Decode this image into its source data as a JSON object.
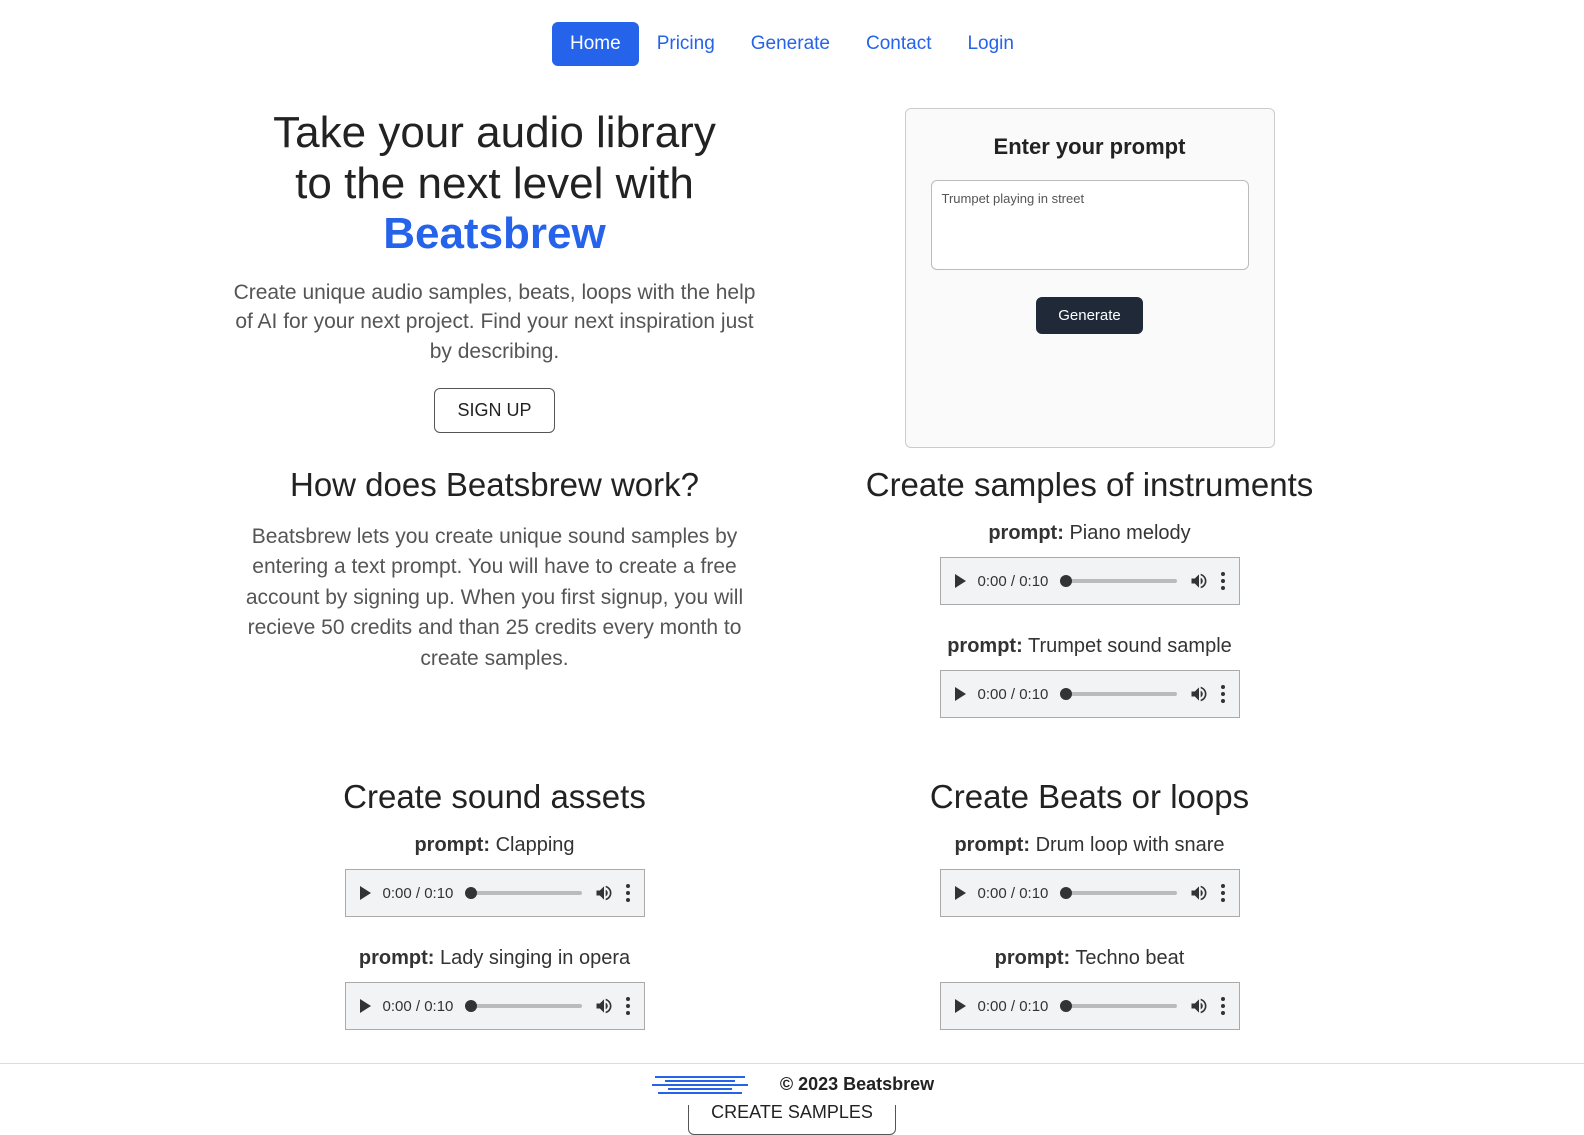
{
  "nav": {
    "items": [
      {
        "label": "Home",
        "active": true
      },
      {
        "label": "Pricing",
        "active": false
      },
      {
        "label": "Generate",
        "active": false
      },
      {
        "label": "Contact",
        "active": false
      },
      {
        "label": "Login",
        "active": false
      }
    ]
  },
  "hero": {
    "title_line1": "Take your audio library",
    "title_line2": "to the next level with",
    "brand": "Beatsbrew",
    "description": "Create unique audio samples, beats, loops with the help of AI for your next project. Find your next inspiration just by describing.",
    "signup_label": "SIGN UP"
  },
  "prompt_card": {
    "title": "Enter your prompt",
    "placeholder": "Trumpet playing in street",
    "value": "Trumpet playing in street",
    "generate_label": "Generate"
  },
  "how_it_works": {
    "heading": "How does Beatsbrew work?",
    "text": "Beatsbrew lets you create unique sound samples by entering a text prompt. You will have to create a free account by signing up. When you first signup, you will recieve 50 credits and than 25 credits every month to create samples."
  },
  "instruments": {
    "heading": "Create samples of instruments",
    "samples": [
      {
        "prompt_label": "prompt:",
        "prompt_value": "Piano melody",
        "time": "0:00 / 0:10"
      },
      {
        "prompt_label": "prompt:",
        "prompt_value": "Trumpet sound sample",
        "time": "0:00 / 0:10"
      }
    ]
  },
  "sound_assets": {
    "heading": "Create sound assets",
    "samples": [
      {
        "prompt_label": "prompt:",
        "prompt_value": "Clapping",
        "time": "0:00 / 0:10"
      },
      {
        "prompt_label": "prompt:",
        "prompt_value": "Lady singing in opera",
        "time": "0:00 / 0:10"
      }
    ]
  },
  "beats": {
    "heading": "Create Beats or loops",
    "samples": [
      {
        "prompt_label": "prompt:",
        "prompt_value": "Drum loop with snare",
        "time": "0:00 / 0:10"
      },
      {
        "prompt_label": "prompt:",
        "prompt_value": "Techno beat",
        "time": "0:00 / 0:10"
      }
    ]
  },
  "cta": {
    "create_samples_label": "CREATE SAMPLES"
  },
  "footer": {
    "copyright": "© 2023 Beatsbrew"
  }
}
